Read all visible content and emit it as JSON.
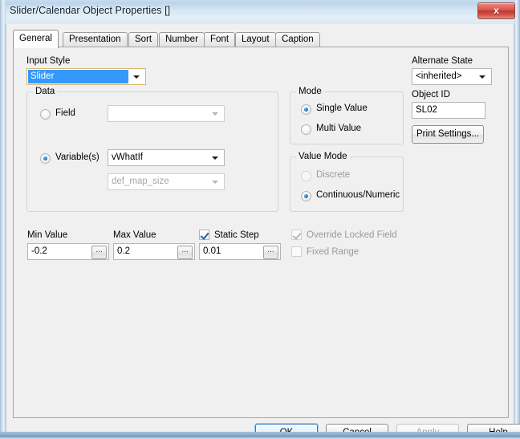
{
  "window": {
    "title": "Slider/Calendar Object Properties []",
    "close_label": "x",
    "close_icon": "close-icon"
  },
  "tabs": [
    {
      "label": "General",
      "active": true
    },
    {
      "label": "Presentation",
      "active": false
    },
    {
      "label": "Sort",
      "active": false
    },
    {
      "label": "Number",
      "active": false
    },
    {
      "label": "Font",
      "active": false
    },
    {
      "label": "Layout",
      "active": false
    },
    {
      "label": "Caption",
      "active": false
    }
  ],
  "general": {
    "input_style": {
      "label": "Input Style",
      "value": "Slider",
      "selected": true
    },
    "data_group": {
      "title": "Data",
      "field": {
        "label": "Field",
        "checked": false,
        "combo_value": "",
        "combo_disabled": true
      },
      "variables": {
        "label": "Variable(s)",
        "checked": true,
        "combo_value": "vWhatIf",
        "secondary_combo_value": "def_map_size",
        "secondary_combo_disabled": true
      }
    },
    "mode_group": {
      "title": "Mode",
      "options": [
        {
          "label": "Single Value",
          "checked": true,
          "disabled": false
        },
        {
          "label": "Multi Value",
          "checked": false,
          "disabled": false
        }
      ]
    },
    "value_mode_group": {
      "title": "Value Mode",
      "options": [
        {
          "label": "Discrete",
          "checked": false,
          "disabled": true
        },
        {
          "label": "Continuous/Numeric",
          "checked": true,
          "disabled": false
        }
      ]
    },
    "min_value": {
      "label": "Min Value",
      "value": "-0.2",
      "browse_label": "..."
    },
    "max_value": {
      "label": "Max Value",
      "value": "0.2",
      "browse_label": "..."
    },
    "static_step": {
      "label": "Static Step",
      "checked": true,
      "value": "0.01",
      "browse_label": "..."
    },
    "override_locked_field": {
      "label": "Override Locked Field",
      "checked": true,
      "disabled": true
    },
    "fixed_range": {
      "label": "Fixed Range",
      "checked": false,
      "disabled": true
    }
  },
  "right_panel": {
    "alternate_state": {
      "label": "Alternate State",
      "value": "<inherited>"
    },
    "object_id": {
      "label": "Object ID",
      "value": "SL02"
    },
    "print_settings": {
      "label": "Print Settings..."
    }
  },
  "buttons": {
    "ok": {
      "label": "OK",
      "disabled": false,
      "default": true
    },
    "cancel": {
      "label": "Cancel",
      "disabled": false
    },
    "apply": {
      "label": "Apply",
      "disabled": true
    },
    "help": {
      "label": "Help",
      "disabled": false
    }
  },
  "colors": {
    "selection_blue": "#3399ff",
    "close_red": "#c0372e",
    "default_focus": "#8fd0f5",
    "dialog_bg": "#f0f0f0"
  }
}
